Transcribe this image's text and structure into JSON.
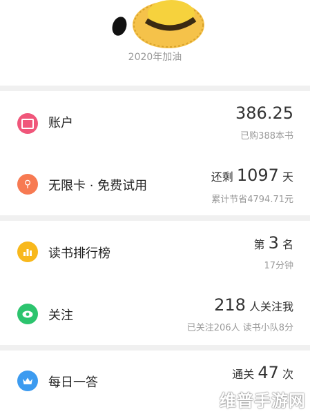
{
  "header": {
    "avatar_icon": "yellow-straw-hat-avatar",
    "motto": "2020年加油"
  },
  "rows": [
    {
      "icon": "wallet-icon",
      "icon_color": "#f0567a",
      "label": "账户",
      "primary_value": "386.25",
      "secondary": "已购388本书"
    },
    {
      "icon": "infinite-card-icon",
      "icon_color": "#f77a52",
      "label": "无限卡 · 免费试用",
      "prefix": "还剩",
      "primary_value": "1097",
      "unit": "天",
      "secondary": "累计节省4794.71元"
    },
    {
      "icon": "ranking-icon",
      "icon_color": "#f8b81c",
      "label": "读书排行榜",
      "prefix": "第",
      "primary_value": "3",
      "unit": "名",
      "secondary": "17分钟"
    },
    {
      "icon": "eye-icon",
      "icon_color": "#2cc46e",
      "label": "关注",
      "primary_value": "218",
      "unit": "人关注我",
      "secondary": "已关注206人 读书小队8分"
    },
    {
      "icon": "crown-icon",
      "icon_color": "#3c9bf0",
      "label": "每日一答",
      "prefix": "通关",
      "primary_value": "47",
      "unit": "次"
    }
  ],
  "watermark": "维普手游网"
}
